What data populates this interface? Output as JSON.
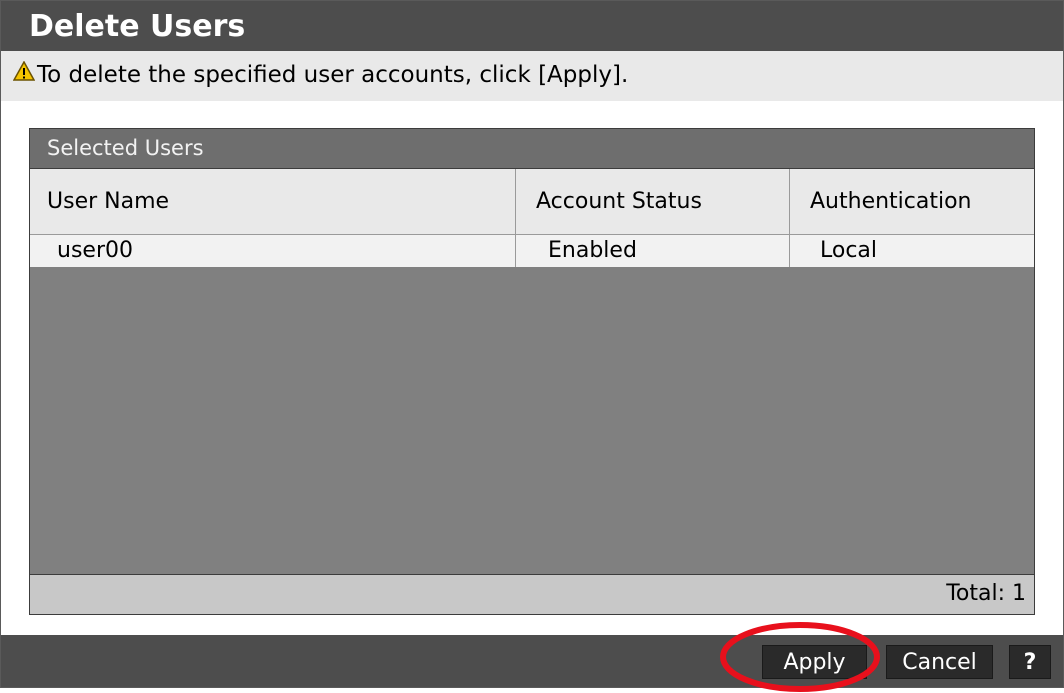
{
  "dialog": {
    "title": "Delete Users",
    "message": "To delete the specified user accounts, click [Apply].",
    "warning_icon": "warning-triangle-icon",
    "colors": {
      "titlebar": "#4d4d4d",
      "panel": "#808080",
      "highlight": "#e8101c"
    }
  },
  "panel": {
    "title": "Selected Users",
    "columns": [
      "User Name",
      "Account Status",
      "Authentication"
    ],
    "rows": [
      {
        "user_name": "user00",
        "account_status": "Enabled",
        "authentication": "Local"
      }
    ],
    "total": "Total: 1"
  },
  "buttons": {
    "apply": "Apply",
    "cancel": "Cancel",
    "help": "?"
  }
}
